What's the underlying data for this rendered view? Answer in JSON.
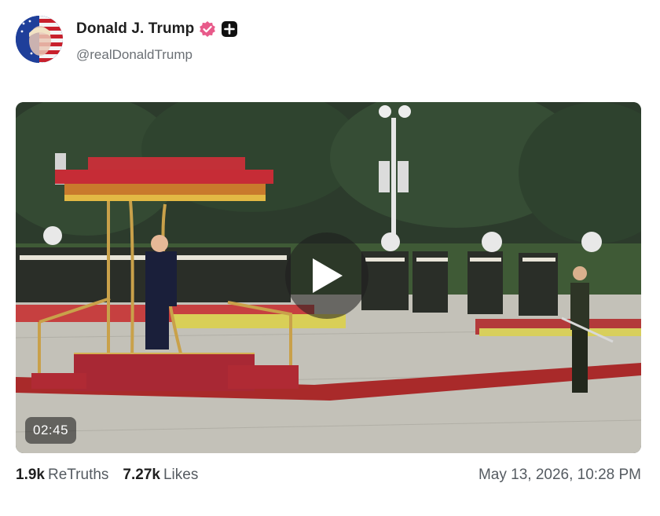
{
  "post": {
    "author": {
      "display_name": "Donald J. Trump",
      "handle": "@realDonaldTrump",
      "verified_color": "#e85a8a",
      "icons": [
        "avatar",
        "verified-icon",
        "plus-badge-icon"
      ]
    },
    "media": {
      "type": "video",
      "duration": "02:45",
      "icons": [
        "play-icon"
      ]
    },
    "stats": {
      "retruths_count": "1.9k",
      "retruths_label": "ReTruths",
      "likes_count": "7.27k",
      "likes_label": "Likes"
    },
    "timestamp": "May 13, 2026, 10:28 PM"
  }
}
